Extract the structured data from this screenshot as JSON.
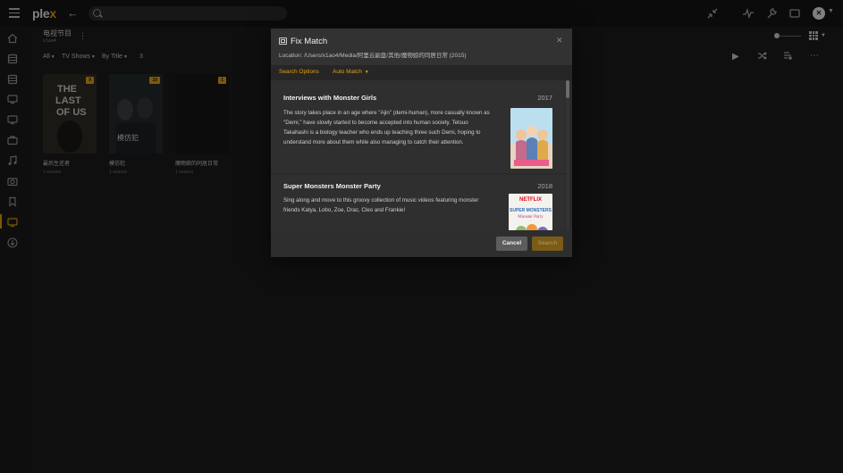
{
  "topbar": {
    "logo_text": "plex",
    "search_placeholder": ""
  },
  "library": {
    "title": "电视节目",
    "user": "x1ao4",
    "filter_all": "All",
    "filter_type": "TV Shows",
    "filter_sort": "By Title",
    "count": "3"
  },
  "shows": [
    {
      "title": "最后生还者",
      "seasons": "1 season",
      "badge": "9"
    },
    {
      "title": "模仿犯",
      "seasons": "1 season",
      "badge": "10"
    },
    {
      "title": "魔物娘的同居日常",
      "seasons": "1 season",
      "badge": "1"
    }
  ],
  "dialog": {
    "title": "Fix Match",
    "location": "Location: /Users/x1ao4/Media/阿里云副盘/其他/魔物娘的同居日常 (2015)",
    "tab_search_options": "Search Options",
    "tab_auto_match": "Auto Match",
    "results": [
      {
        "title": "Interviews with Monster Girls",
        "year": "2017",
        "summary": "The story takes place in an age where \"Ajin\" (demi-human), more casually known as \"Demi,\" have slowly started to become accepted into human society. Tetsuo Takahashi is a biology teacher who ends up teaching three such Demi, hoping to understand more about them while also managing to catch their attention."
      },
      {
        "title": "Super Monsters Monster Party",
        "year": "2018",
        "summary": "Sing along and move to this groovy collection of music videos featuring monster friends Katya, Lobo, Zoe, Drac, Cleo and Frankie!",
        "poster_brand": "NETFLIX",
        "poster_line1": "SUPER MONSTERS",
        "poster_line2": "Monster Party"
      }
    ],
    "cancel_label": "Cancel",
    "search_label": "Search"
  },
  "colors": {
    "accent": "#e5a00d",
    "background": "#1c1c1c",
    "dialog": "#2b2b2b"
  },
  "icons": {
    "sidebar": [
      "home-icon",
      "film-icon",
      "film-icon",
      "tv-icon",
      "tv-icon",
      "briefcase-icon",
      "music-icon",
      "camera-icon",
      "bookmark-icon",
      "tv-icon",
      "download-icon"
    ],
    "topbar": [
      "collapse-icon",
      "activity-icon",
      "wrench-icon",
      "cast-icon"
    ]
  }
}
